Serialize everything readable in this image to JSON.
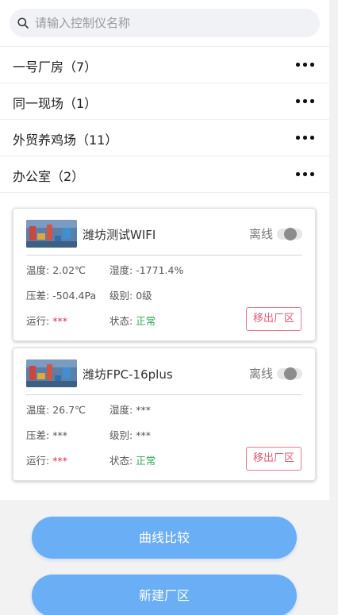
{
  "search": {
    "placeholder": "请输入控制仪名称",
    "value": ""
  },
  "factories": [
    {
      "label": "一号厂房（7）"
    },
    {
      "label": "同一现场（1）"
    },
    {
      "label": "外贸养鸡场（11）"
    },
    {
      "label": "办公室（2）"
    }
  ],
  "devices": [
    {
      "name": "潍坊测试WIFI",
      "status_text": "离线",
      "online": false,
      "temp_label": "温度:",
      "temp": "2.02℃",
      "humidity_label": "湿度:",
      "humidity": "-1771.4%",
      "pressure_label": "压差:",
      "pressure": "-504.4Pa",
      "level_label": "级别:",
      "level": "0级",
      "run_label": "运行:",
      "run": "***",
      "state_label": "状态:",
      "state": "正常",
      "remove_label": "移出厂区"
    },
    {
      "name": "潍坊FPC-16plus",
      "status_text": "离线",
      "online": false,
      "temp_label": "温度:",
      "temp": "26.7℃",
      "humidity_label": "湿度:",
      "humidity": "***",
      "pressure_label": "压差:",
      "pressure": "***",
      "level_label": "级别:",
      "level": "***",
      "run_label": "运行:",
      "run": "***",
      "state_label": "状态:",
      "state": "正常",
      "remove_label": "移出厂区"
    }
  ],
  "actions": {
    "compare_label": "曲线比较",
    "new_factory_label": "新建厂区"
  },
  "colors": {
    "primary": "#6aaef6",
    "danger": "#d9304a",
    "success": "#2eaa5a",
    "remove_border": "#e57b90"
  },
  "icons": {
    "search": "search-icon",
    "more": "more-dots-icon",
    "thumbnail": "device-thumbnail-icon"
  }
}
